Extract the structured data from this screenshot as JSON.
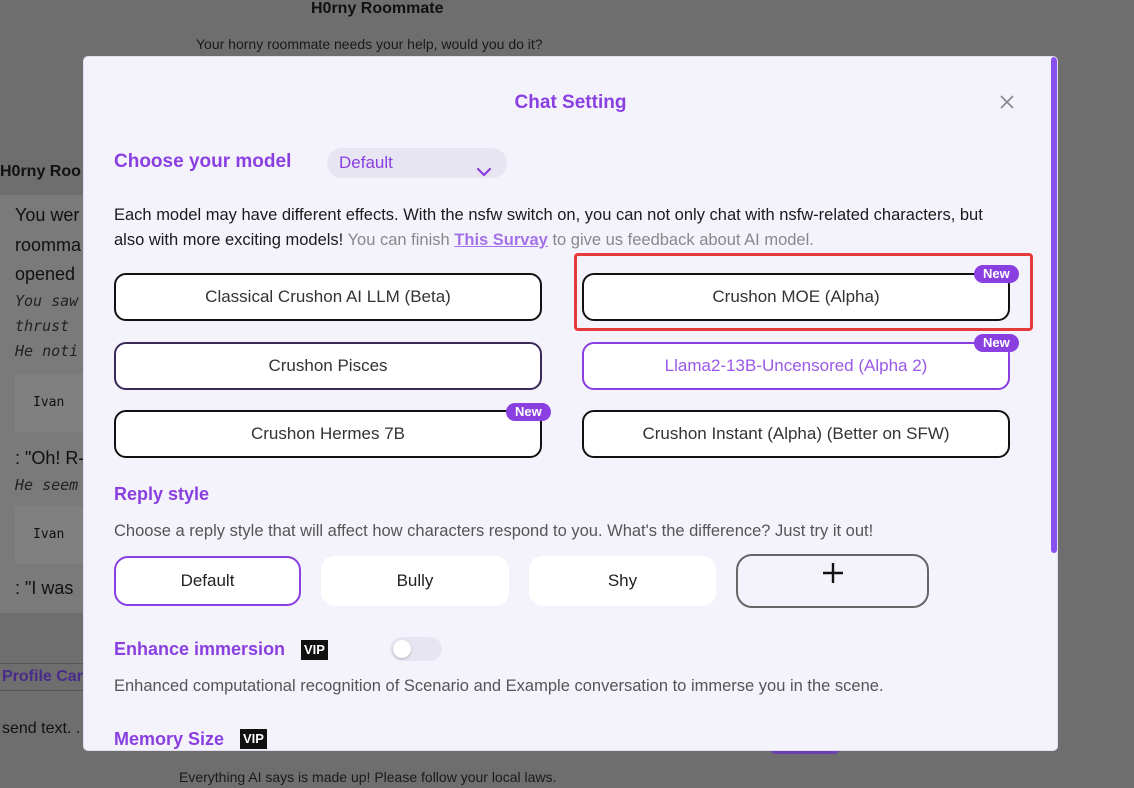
{
  "background": {
    "title": "H0rny Roommate",
    "description": "Your horny roommate needs your help, would you do it?",
    "sidebar_name": "H0rny Roo",
    "chat_lines": [
      "You wer",
      "roomma",
      "opened"
    ],
    "narration_lines": [
      "You saw",
      "thrust",
      "He noti"
    ],
    "code_name_1": "Ivan",
    "quote_1": ": \"Oh! R-",
    "narration_2": "He seem",
    "code_name_2": "Ivan",
    "quote_2": ": \"I was",
    "profile_tab": "Profile Car",
    "send_placeholder": "send text. .",
    "footer": "Everything AI says is made up! Please follow your local laws."
  },
  "modal": {
    "title": "Chat Setting",
    "close_icon": "close-icon",
    "model_section": {
      "heading": "Choose your model",
      "selected": "Default",
      "info_main": "Each model may have different effects. With the nsfw switch on, you can not only chat with nsfw-related characters, but also with more exciting models!",
      "info_muted_1": "You can finish",
      "info_link": "This Survay",
      "info_muted_2": "to give us feedback about AI model.",
      "models": [
        {
          "label": "Classical Crushon AI LLM (Beta)",
          "badge": ""
        },
        {
          "label": "Crushon MOE (Alpha)",
          "badge": "New"
        },
        {
          "label": "Crushon Pisces",
          "badge": ""
        },
        {
          "label": "Llama2-13B-Uncensored (Alpha 2)",
          "badge": "New"
        },
        {
          "label": "Crushon Hermes 7B",
          "badge": "New"
        },
        {
          "label": "Crushon Instant (Alpha) (Better on SFW)",
          "badge": ""
        }
      ]
    },
    "reply_section": {
      "heading": "Reply style",
      "description": "Choose a reply style that will affect how characters respond to you. What's the difference?  Just try it out!",
      "styles": [
        "Default",
        "Bully",
        "Shy"
      ],
      "add_label": "+"
    },
    "immersion_section": {
      "heading": "Enhance immersion",
      "vip": "VIP",
      "enabled": false,
      "description": "Enhanced computational recognition of Scenario and Example conversation to immerse you in the scene."
    },
    "memory_section": {
      "heading": "Memory Size",
      "vip": "VIP"
    }
  },
  "colors": {
    "accent": "#8a3fe0",
    "highlight": "#e53a3a",
    "overlay": "#6e6e6e"
  }
}
